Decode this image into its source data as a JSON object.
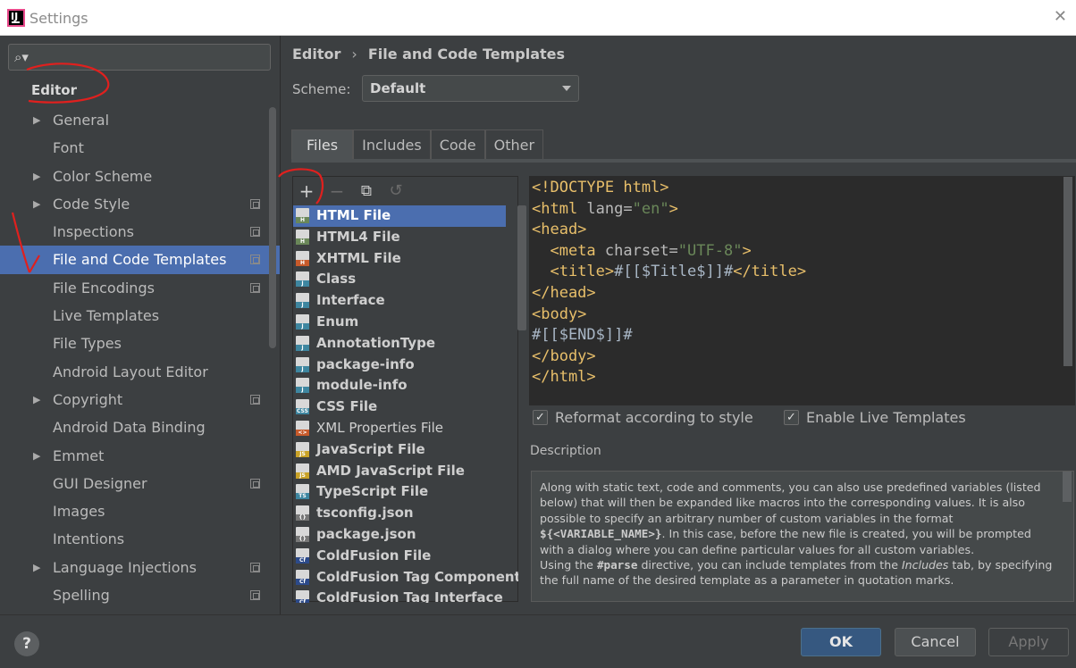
{
  "window": {
    "title": "Settings",
    "close_glyph": "✕",
    "logo_letters": "IJ"
  },
  "search": {
    "placeholder": "",
    "icon": "search-icon"
  },
  "sidebar": {
    "heading": "Editor",
    "items": [
      {
        "label": "General",
        "expandable": true,
        "project": false,
        "selected": false
      },
      {
        "label": "Font",
        "expandable": false,
        "project": false,
        "selected": false
      },
      {
        "label": "Color Scheme",
        "expandable": true,
        "project": false,
        "selected": false
      },
      {
        "label": "Code Style",
        "expandable": true,
        "project": true,
        "selected": false
      },
      {
        "label": "Inspections",
        "expandable": false,
        "project": true,
        "selected": false
      },
      {
        "label": "File and Code Templates",
        "expandable": false,
        "project": true,
        "selected": true
      },
      {
        "label": "File Encodings",
        "expandable": false,
        "project": true,
        "selected": false
      },
      {
        "label": "Live Templates",
        "expandable": false,
        "project": false,
        "selected": false
      },
      {
        "label": "File Types",
        "expandable": false,
        "project": false,
        "selected": false
      },
      {
        "label": "Android Layout Editor",
        "expandable": false,
        "project": false,
        "selected": false
      },
      {
        "label": "Copyright",
        "expandable": true,
        "project": true,
        "selected": false
      },
      {
        "label": "Android Data Binding",
        "expandable": false,
        "project": false,
        "selected": false
      },
      {
        "label": "Emmet",
        "expandable": true,
        "project": false,
        "selected": false
      },
      {
        "label": "GUI Designer",
        "expandable": false,
        "project": true,
        "selected": false
      },
      {
        "label": "Images",
        "expandable": false,
        "project": false,
        "selected": false
      },
      {
        "label": "Intentions",
        "expandable": false,
        "project": false,
        "selected": false
      },
      {
        "label": "Language Injections",
        "expandable": true,
        "project": true,
        "selected": false
      },
      {
        "label": "Spelling",
        "expandable": false,
        "project": true,
        "selected": false
      }
    ]
  },
  "breadcrumb": {
    "parent": "Editor",
    "separator": "›",
    "current": "File and Code Templates"
  },
  "scheme": {
    "label": "Scheme:",
    "value": "Default"
  },
  "tabs": [
    {
      "label": "Files",
      "active": true
    },
    {
      "label": "Includes",
      "active": false
    },
    {
      "label": "Code",
      "active": false
    },
    {
      "label": "Other",
      "active": false
    }
  ],
  "toolbar": {
    "add": "+",
    "remove": "−",
    "copy": "⧉",
    "reset": "↺"
  },
  "templates": [
    {
      "name": "HTML File",
      "icon": "html-file-icon",
      "badge": "H",
      "color": "#6a8759",
      "selected": true,
      "bold": true
    },
    {
      "name": "HTML4 File",
      "icon": "html-file-icon",
      "badge": "H",
      "color": "#6a8759",
      "selected": false,
      "bold": true
    },
    {
      "name": "XHTML File",
      "icon": "html-file-icon",
      "badge": "H",
      "color": "#c75a2b",
      "selected": false,
      "bold": true
    },
    {
      "name": "Class",
      "icon": "java-file-icon",
      "badge": "J",
      "color": "#3e86a0",
      "selected": false,
      "bold": true
    },
    {
      "name": "Interface",
      "icon": "java-file-icon",
      "badge": "J",
      "color": "#3e86a0",
      "selected": false,
      "bold": true
    },
    {
      "name": "Enum",
      "icon": "java-file-icon",
      "badge": "J",
      "color": "#3e86a0",
      "selected": false,
      "bold": true
    },
    {
      "name": "AnnotationType",
      "icon": "java-file-icon",
      "badge": "J",
      "color": "#3e86a0",
      "selected": false,
      "bold": true
    },
    {
      "name": "package-info",
      "icon": "java-file-icon",
      "badge": "J",
      "color": "#3e86a0",
      "selected": false,
      "bold": true
    },
    {
      "name": "module-info",
      "icon": "java-file-icon",
      "badge": "J",
      "color": "#3e86a0",
      "selected": false,
      "bold": true
    },
    {
      "name": "CSS File",
      "icon": "css-file-icon",
      "badge": "CSS",
      "color": "#3e86a0",
      "selected": false,
      "bold": true
    },
    {
      "name": "XML Properties File",
      "icon": "xml-file-icon",
      "badge": "<>",
      "color": "#c75a2b",
      "selected": false,
      "bold": false
    },
    {
      "name": "JavaScript File",
      "icon": "js-file-icon",
      "badge": "JS",
      "color": "#c9a227",
      "selected": false,
      "bold": true
    },
    {
      "name": "AMD JavaScript File",
      "icon": "js-file-icon",
      "badge": "JS",
      "color": "#c9a227",
      "selected": false,
      "bold": true
    },
    {
      "name": "TypeScript File",
      "icon": "ts-file-icon",
      "badge": "TS",
      "color": "#3e86a0",
      "selected": false,
      "bold": true
    },
    {
      "name": "tsconfig.json",
      "icon": "json-file-icon",
      "badge": "{}",
      "color": "#777777",
      "selected": false,
      "bold": true
    },
    {
      "name": "package.json",
      "icon": "json-file-icon",
      "badge": "{}",
      "color": "#777777",
      "selected": false,
      "bold": true
    },
    {
      "name": "ColdFusion File",
      "icon": "coldfusion-file-icon",
      "badge": "Cf",
      "color": "#2c4a8a",
      "selected": false,
      "bold": true
    },
    {
      "name": "ColdFusion Tag Component",
      "icon": "coldfusion-file-icon",
      "badge": "Cf",
      "color": "#2c4a8a",
      "selected": false,
      "bold": true
    },
    {
      "name": "ColdFusion Tag Interface",
      "icon": "coldfusion-file-icon",
      "badge": "Cf",
      "color": "#2c4a8a",
      "selected": false,
      "bold": true
    }
  ],
  "editor": {
    "lines": [
      [
        [
          "tag",
          "<!DOCTYPE html>"
        ]
      ],
      [
        [
          "tag",
          "<html "
        ],
        [
          "attr",
          "lang="
        ],
        [
          "str",
          "\"en\""
        ],
        [
          "tag",
          ">"
        ]
      ],
      [
        [
          "tag",
          "<head>"
        ]
      ],
      [
        [
          "plain",
          "  "
        ],
        [
          "tag",
          "<meta "
        ],
        [
          "attr",
          "charset="
        ],
        [
          "str",
          "\"UTF-8\""
        ],
        [
          "tag",
          ">"
        ]
      ],
      [
        [
          "plain",
          "  "
        ],
        [
          "tag",
          "<title>"
        ],
        [
          "plain",
          "#[[$Title$]]#"
        ],
        [
          "tag",
          "</title>"
        ]
      ],
      [
        [
          "tag",
          "</head>"
        ]
      ],
      [
        [
          "tag",
          "<body>"
        ]
      ],
      [
        [
          "plain",
          "#[[$END$]]#"
        ]
      ],
      [
        [
          "tag",
          "</body>"
        ]
      ],
      [
        [
          "tag",
          "</html>"
        ]
      ]
    ]
  },
  "options": {
    "reformat": {
      "label": "Reformat according to style",
      "checked": true
    },
    "live_templates": {
      "label": "Enable Live Templates",
      "checked": true
    }
  },
  "description": {
    "title": "Description",
    "p1_a": "Along with static text, code and comments, you can also use predefined variables (listed below) that will then be expanded like macros into the corresponding values. It is also possible to specify an arbitrary number of custom variables in the format ",
    "p1_var": "${<VARIABLE_NAME>}",
    "p1_b": ". In this case, before the new file is created, you will be prompted with a dialog where you can define particular values for all custom variables.",
    "p2_a": "Using the ",
    "p2_kw": "#parse",
    "p2_b": " directive, you can include templates from the ",
    "p2_tab": "Includes",
    "p2_c": " tab, by specifying the full name of the desired template as a parameter in quotation marks."
  },
  "buttons": {
    "help": "?",
    "ok": "OK",
    "cancel": "Cancel",
    "apply": "Apply"
  },
  "colors": {
    "selection": "#4b6eaf",
    "background": "#3c3f41",
    "editor_bg": "#2b2b2b",
    "annotation": "#e0201e"
  }
}
